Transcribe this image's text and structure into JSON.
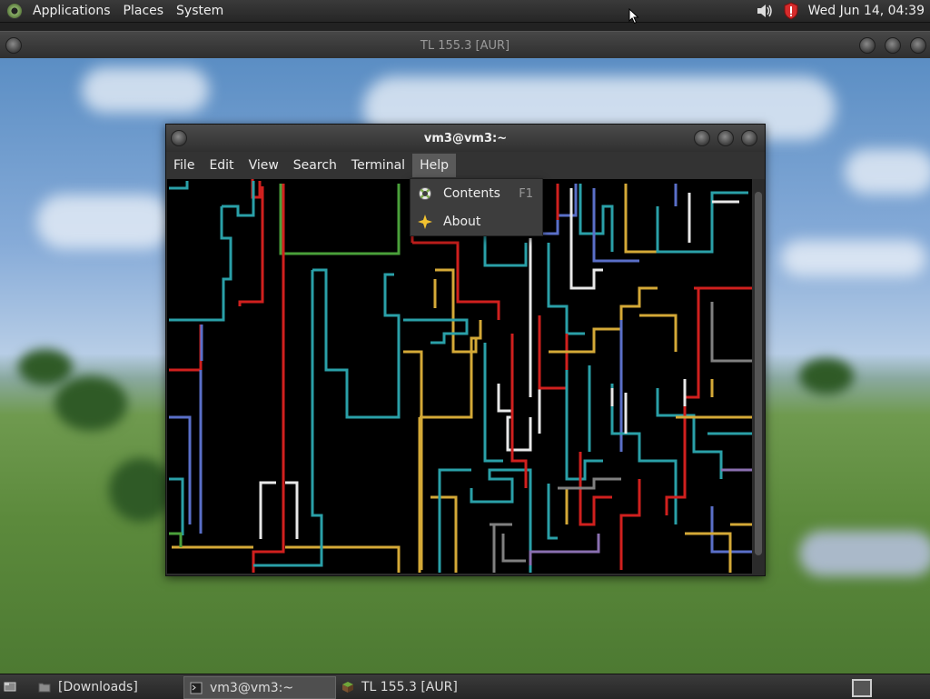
{
  "top_panel": {
    "menus": [
      "Applications",
      "Places",
      "System"
    ],
    "clock": "Wed Jun 14, 04:39",
    "icons": [
      "distro-logo-icon",
      "volume-icon",
      "security-shield-icon"
    ]
  },
  "background_window": {
    "title": "TL 155.3 [AUR]"
  },
  "terminal": {
    "title": "vm3@vm3:~",
    "menus": [
      "File",
      "Edit",
      "View",
      "Search",
      "Terminal",
      "Help"
    ],
    "active_menu": "Help",
    "screen_colors": [
      "#2aa0a8",
      "#d0201e",
      "#d4a937",
      "#5a6fc8",
      "#e8e8e8",
      "#4aa03a",
      "#8a6fb0",
      "#808080"
    ]
  },
  "help_menu": {
    "items": [
      {
        "label": "Contents",
        "accel": "F1",
        "icon": "help-lifebuoy-icon"
      },
      {
        "label": "About",
        "accel": "",
        "icon": "about-star-icon"
      }
    ]
  },
  "taskbar": {
    "tasks": [
      {
        "label": "[Downloads]",
        "icon": "folder-icon",
        "active": false
      },
      {
        "label": "vm3@vm3:~",
        "icon": "terminal-icon",
        "active": true
      },
      {
        "label": "TL 155.3 [AUR]",
        "icon": "game-block-icon",
        "active": false
      }
    ]
  }
}
